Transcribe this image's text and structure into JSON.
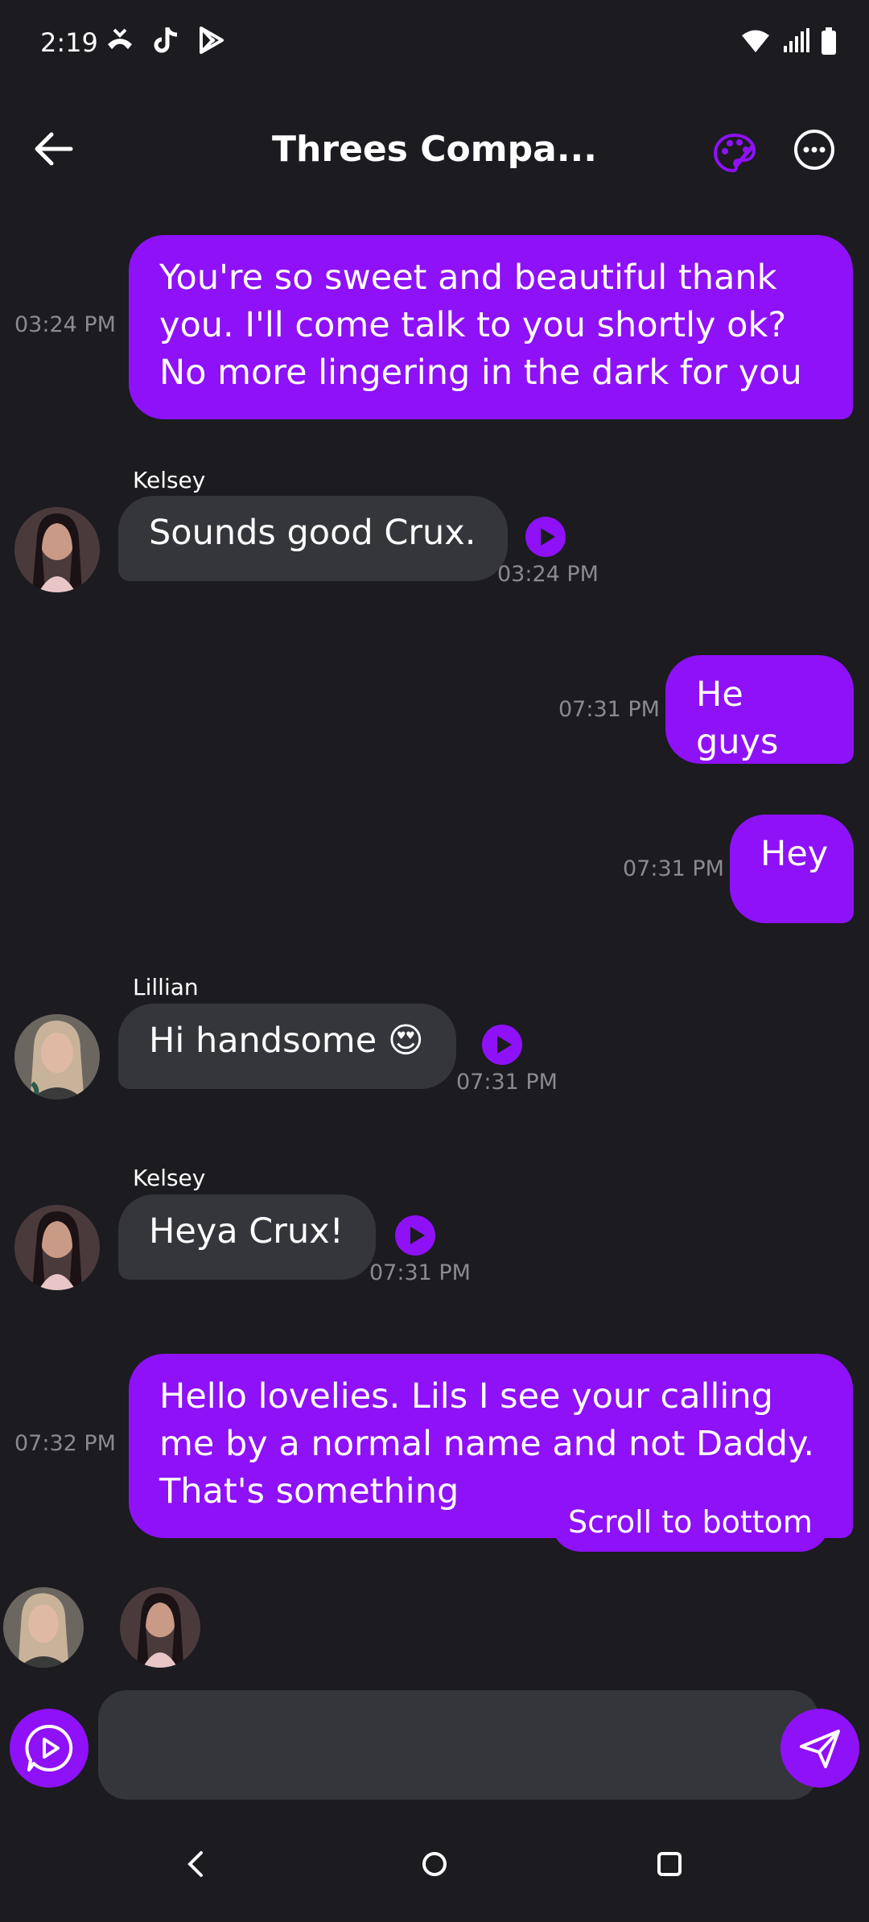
{
  "status_bar": {
    "time": "2:19"
  },
  "header": {
    "title": "Threes Compa..."
  },
  "messages": [
    {
      "text": "You're so sweet and beautiful thank you. I'll come talk to you shortly ok? No more lingering in the dark for you",
      "time": "03:24 PM"
    },
    {
      "sender": "Kelsey",
      "text": "Sounds good Crux.",
      "time": "03:24 PM"
    },
    {
      "text": "He guys",
      "time": "07:31 PM"
    },
    {
      "text": "Hey",
      "time": "07:31 PM"
    },
    {
      "sender": "Lillian",
      "text": "Hi handsome 😍",
      "time": "07:31 PM"
    },
    {
      "sender": "Kelsey",
      "text": "Heya Crux!",
      "time": "07:31 PM"
    },
    {
      "text": "Hello lovelies. Lils I see your calling me by a normal name and not Daddy. That's something",
      "time": "07:32 PM"
    }
  ],
  "scroll_button": {
    "label": "Scroll to bottom"
  },
  "composer": {
    "value": ""
  },
  "colors": {
    "accent": "#8e11f8",
    "background": "#1b1b20",
    "incoming_bubble": "#35363c"
  },
  "icons": [
    "back-arrow-icon",
    "palette-icon",
    "more-options-icon",
    "play-icon",
    "voice-message-icon",
    "send-icon"
  ]
}
